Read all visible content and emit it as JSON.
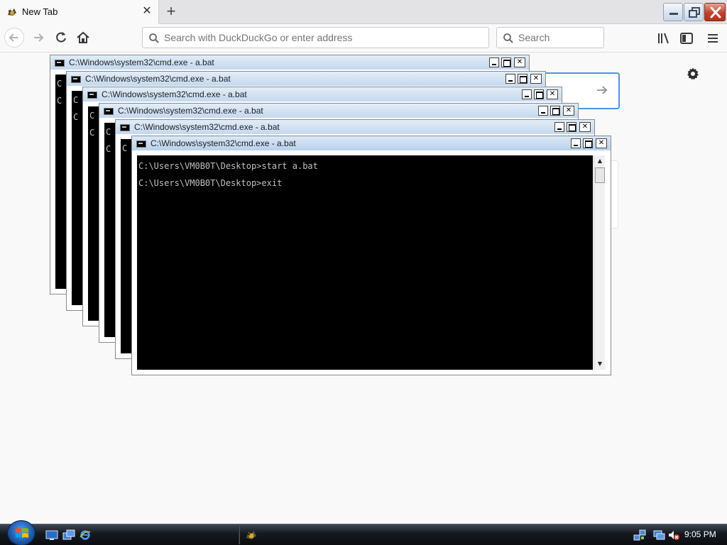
{
  "browser": {
    "tab": {
      "title": "New Tab",
      "close_glyph": "✕"
    },
    "new_tab_glyph": "+",
    "urlbar": {
      "placeholder": "Search with DuckDuckGo or enter address"
    },
    "searchbar": {
      "placeholder": "Search"
    },
    "icons": {
      "back": "arrow-left-icon",
      "forward": "arrow-right-icon",
      "reload": "reload-icon",
      "home": "home-icon",
      "library": "library-icon",
      "sidebar": "sidebar-icon",
      "menu": "hamburger-menu-icon",
      "settings": "gear-icon"
    },
    "accent_color": "#4d94e8"
  },
  "cmd_windows": [
    {
      "title": "C:\\Windows\\system32\\cmd.exe - a.bat",
      "lines": [
        "C",
        "C"
      ]
    },
    {
      "title": "C:\\Windows\\system32\\cmd.exe - a.bat",
      "lines": [
        "C",
        "C"
      ]
    },
    {
      "title": "C:\\Windows\\system32\\cmd.exe - a.bat",
      "lines": [
        "C",
        "C"
      ]
    },
    {
      "title": "C:\\Windows\\system32\\cmd.exe - a.bat",
      "lines": [
        "C",
        "C"
      ]
    },
    {
      "title": "C:\\Windows\\system32\\cmd.exe - a.bat",
      "lines": [
        "C"
      ]
    },
    {
      "title": "C:\\Windows\\system32\\cmd.exe - a.bat",
      "lines": [
        "C:\\Users\\VM0B0T\\Desktop>start a.bat",
        "C:\\Users\\VM0B0T\\Desktop>exit"
      ]
    }
  ],
  "taskbar": {
    "clock": "9:05 PM",
    "icons": [
      "windows-start-icon",
      "show-desktop-icon",
      "switch-windows-icon",
      "internet-explorer-icon",
      "firefox-icon",
      "network-icon",
      "network-status-icon",
      "volume-muted-icon"
    ]
  }
}
